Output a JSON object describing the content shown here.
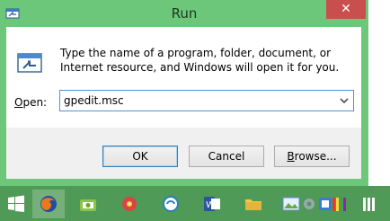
{
  "window": {
    "title": "Run",
    "close_label": "✕",
    "description": "Type the name of a program, folder, document, or Internet resource, and Windows will open it for you."
  },
  "open_field": {
    "label_accel": "O",
    "label_rest": "pen:",
    "value": "gpedit.msc"
  },
  "buttons": {
    "ok": "OK",
    "cancel": "Cancel",
    "browse_accel": "B",
    "browse_rest": "rowse..."
  },
  "taskbar": {
    "items": [
      {
        "icon": "windows-start-icon"
      },
      {
        "icon": "firefox-icon"
      },
      {
        "icon": "android-tool-icon"
      },
      {
        "icon": "disc-burner-icon"
      },
      {
        "icon": "browser-icon"
      },
      {
        "icon": "word-icon"
      },
      {
        "icon": "folder-icon"
      },
      {
        "icon": "photo-icon"
      },
      {
        "icon": "settings-icon"
      },
      {
        "icon": "tile-app-icon"
      },
      {
        "icon": "color-bars-icon"
      },
      {
        "icon": "stripes-icon"
      }
    ]
  },
  "colors": {
    "window_frame": "#6dc77a",
    "close_button": "#c94f4f",
    "taskbar": "#4f9a57",
    "accent": "#4f93d8"
  }
}
